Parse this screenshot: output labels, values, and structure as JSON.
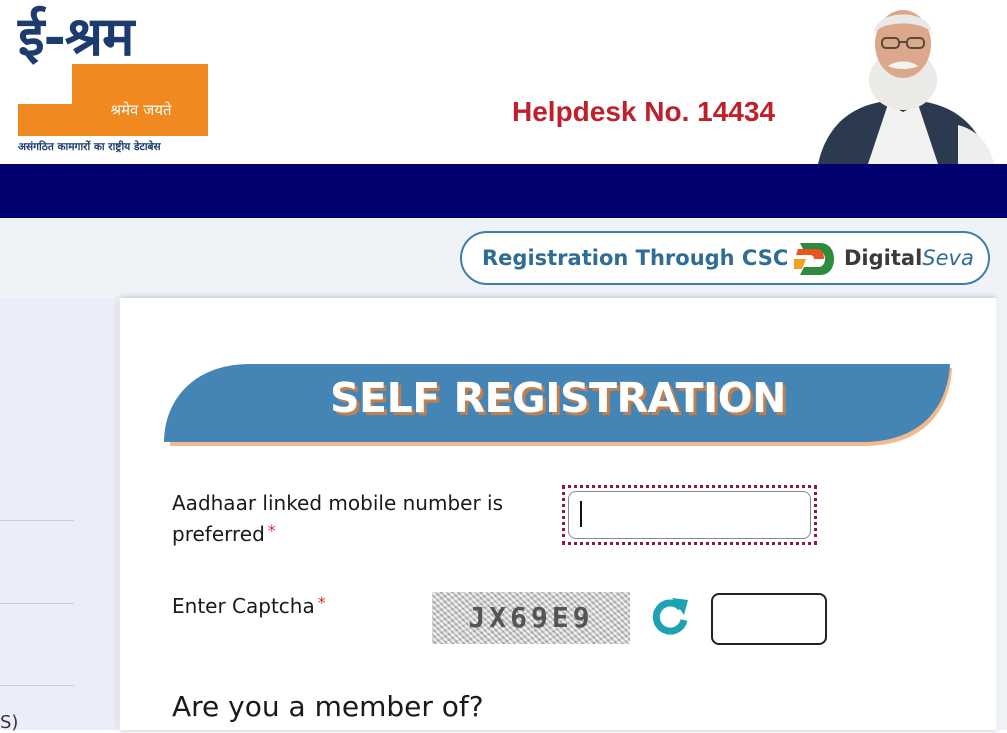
{
  "header": {
    "logo": {
      "title": "ई-श्रम",
      "motto": "श्रमेव जयते",
      "tagline": "असंगठित कामगारों का राष्ट्रीय डेटाबेस"
    },
    "helpdesk": "Helpdesk No. 14434"
  },
  "csc_button": {
    "label": "Registration Through CSC",
    "brand_digital": "Digital",
    "brand_seva": "Seva"
  },
  "form": {
    "heading": "SELF REGISTRATION",
    "mobile_label": "Aadhaar linked mobile number is preferred",
    "mobile_value": "",
    "captcha_label": "Enter Captcha",
    "required_mark": "*",
    "captcha_code": "JX69E9",
    "captcha_value": "",
    "member_question": "Are you a member of?"
  },
  "left_panel": {
    "partial_text": "S)"
  },
  "colors": {
    "navbar": "#000070",
    "banner": "#4585b6",
    "helpdesk": "#c0202b",
    "logo_orange": "#f0891f",
    "logo_navy": "#1d3c6e",
    "csc_border": "#3e7fa8"
  }
}
